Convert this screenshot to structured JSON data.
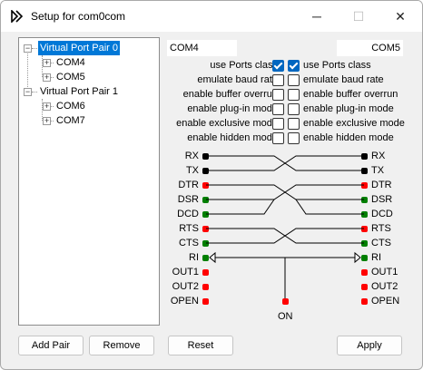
{
  "window": {
    "title": "Setup for com0com",
    "minimize_glyph": "─",
    "maximize_glyph": "☐",
    "close_glyph": "✕"
  },
  "tree": [
    {
      "label": "Virtual Port Pair 0",
      "selected": true,
      "children": [
        "COM4",
        "COM5"
      ]
    },
    {
      "label": "Virtual Port Pair 1",
      "selected": false,
      "children": [
        "COM6",
        "COM7"
      ]
    }
  ],
  "left_port": {
    "name": "COM4"
  },
  "right_port": {
    "name": "COM5"
  },
  "options": [
    {
      "label": "use Ports class",
      "left": true,
      "right": true
    },
    {
      "label": "emulate baud rate",
      "left": false,
      "right": false
    },
    {
      "label": "enable buffer overrun",
      "left": false,
      "right": false
    },
    {
      "label": "enable plug-in mode",
      "left": false,
      "right": false
    },
    {
      "label": "enable exclusive mode",
      "left": false,
      "right": false
    },
    {
      "label": "enable hidden mode",
      "left": false,
      "right": false
    }
  ],
  "signals": [
    {
      "name": "RX",
      "left_color": "black",
      "right_color": "black"
    },
    {
      "name": "TX",
      "left_color": "black",
      "right_color": "black"
    },
    {
      "name": "DTR",
      "left_color": "red",
      "right_color": "red"
    },
    {
      "name": "DSR",
      "left_color": "green",
      "right_color": "green"
    },
    {
      "name": "DCD",
      "left_color": "green",
      "right_color": "green"
    },
    {
      "name": "RTS",
      "left_color": "red",
      "right_color": "red"
    },
    {
      "name": "CTS",
      "left_color": "green",
      "right_color": "green"
    },
    {
      "name": "RI",
      "left_color": "green",
      "right_color": "green"
    },
    {
      "name": "OUT1",
      "left_color": "red",
      "right_color": "red"
    },
    {
      "name": "OUT2",
      "left_color": "red",
      "right_color": "red"
    },
    {
      "name": "OPEN",
      "left_color": "red",
      "right_color": "red"
    }
  ],
  "on_label": "ON",
  "colors": {
    "red": "#ff0000",
    "green": "#007f00",
    "black": "#000000",
    "selection": "#0078d7"
  },
  "buttons": {
    "add_pair": "Add Pair",
    "remove": "Remove",
    "reset": "Reset",
    "apply": "Apply"
  }
}
